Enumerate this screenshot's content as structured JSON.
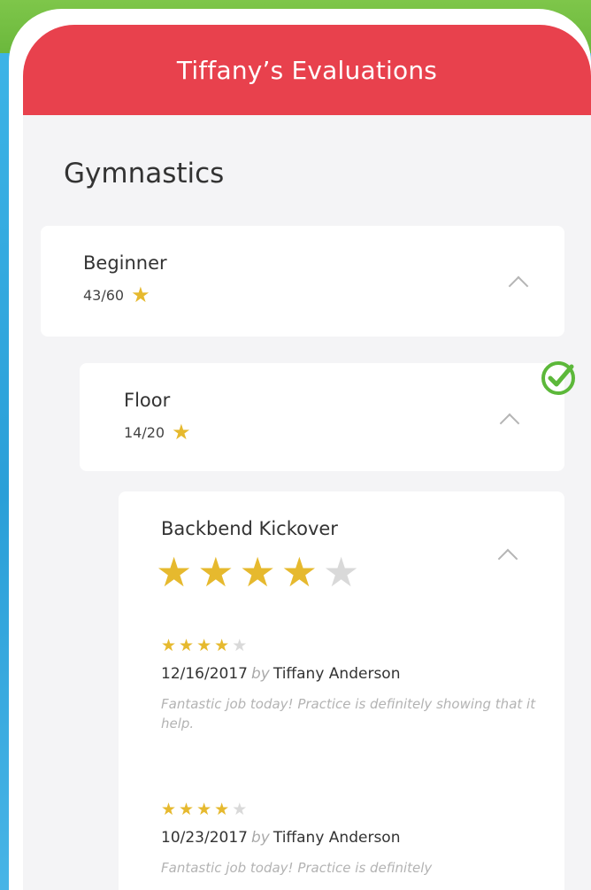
{
  "header": {
    "title": "Tiffany’s Evaluations"
  },
  "section": {
    "title": "Gymnastics"
  },
  "level": {
    "name": "Beginner",
    "score": "43/60"
  },
  "event": {
    "name": "Floor",
    "score": "14/20",
    "completed": true
  },
  "skill": {
    "name": "Backbend Kickover",
    "rating": 4,
    "max_rating": 5,
    "reviews": [
      {
        "rating": 4,
        "date": "12/16/2017",
        "by": "by",
        "author": "Tiffany Anderson",
        "comment": "Fantastic job today! Practice is definitely showing that it help."
      },
      {
        "rating": 4,
        "date": "10/23/2017",
        "by": "by",
        "author": "Tiffany Anderson",
        "comment": "Fantastic job today! Practice is definitely"
      }
    ]
  },
  "colors": {
    "header_red": "#e8414d",
    "star_gold": "#e6b92e",
    "check_green": "#5cb83a",
    "background_blue": "#2a9fd8"
  }
}
